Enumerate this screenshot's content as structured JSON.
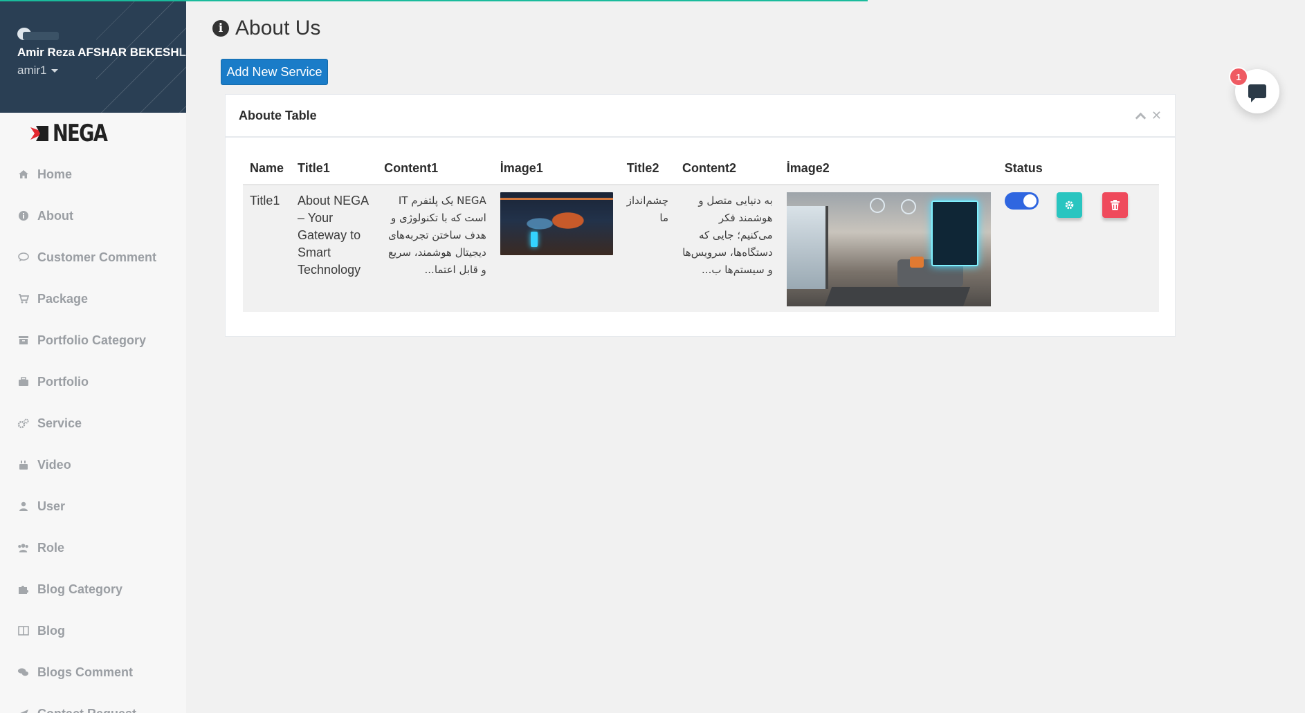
{
  "user": {
    "full_name": "Amir Reza AFSHAR BEKESH",
    "full_name_tail": "LOO",
    "username": "amir1"
  },
  "brand": {
    "name": "NEGA"
  },
  "sidebar": {
    "items": [
      {
        "label": "Home",
        "icon": "home-icon"
      },
      {
        "label": "About",
        "icon": "info-icon"
      },
      {
        "label": "Customer Comment",
        "icon": "comment-icon"
      },
      {
        "label": "Package",
        "icon": "cart-icon"
      },
      {
        "label": "Portfolio Category",
        "icon": "archive-icon"
      },
      {
        "label": "Portfolio",
        "icon": "briefcase-icon"
      },
      {
        "label": "Service",
        "icon": "cogs-icon"
      },
      {
        "label": "Video",
        "icon": "youtube-icon"
      },
      {
        "label": "User",
        "icon": "user-icon"
      },
      {
        "label": "Role",
        "icon": "users-icon"
      },
      {
        "label": "Blog Category",
        "icon": "puzzle-icon"
      },
      {
        "label": "Blog",
        "icon": "columns-icon"
      },
      {
        "label": "Blogs Comment",
        "icon": "comments-icon"
      },
      {
        "label": "Contact Request",
        "icon": "send-icon"
      }
    ]
  },
  "page": {
    "title": "About Us",
    "add_button": "Add New Service"
  },
  "panel": {
    "title": "Aboute Table",
    "table": {
      "headers": [
        "Name",
        "Title1",
        "Content1",
        "İmage1",
        "Title2",
        "Content2",
        "İmage2",
        "Status",
        "",
        ""
      ],
      "rows": [
        {
          "name": "Title1",
          "title1": "About NEGA – Your Gateway to Smart Technology",
          "content1": "NEGA یک پلتفرم IT است که با تکنولوژی و هدف ساختن تجربه‌های دیجیتال هوشمند، سریع و قابل اعتما...",
          "title2": "چشم‌انداز ما",
          "content2": "به دنیایی متصل و هوشمند فکر می‌کنیم؛ جایی که دستگاه‌ها، سرویس‌ها و سیستم‌ها ب...",
          "status": true
        }
      ]
    }
  },
  "chat": {
    "badge": "1"
  },
  "colors": {
    "sidebar_profile_bg": "#2a3f54",
    "primary_button": "#1a7cc8",
    "toggle_on": "#2f66e0",
    "settings_button": "#29c5c0",
    "delete_button": "#ef4a5c",
    "badge": "#ef5a62",
    "progress": "#1abb9c"
  }
}
